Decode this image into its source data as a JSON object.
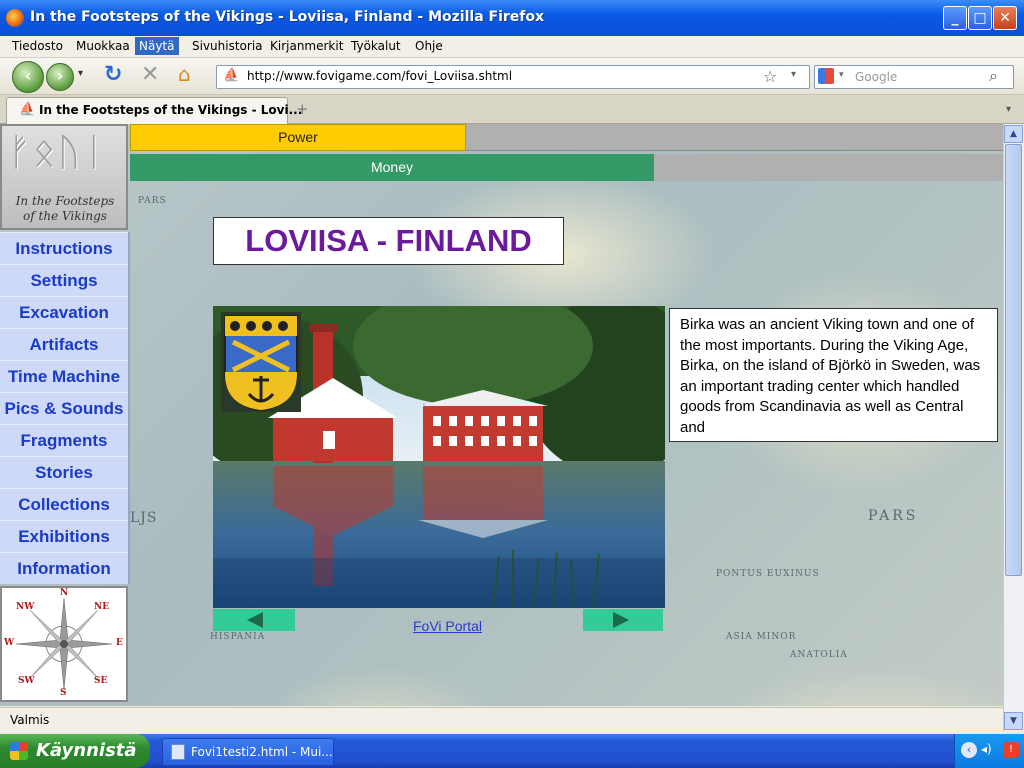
{
  "window": {
    "title": "In the Footsteps of the Vikings - Loviisa, Finland - Mozilla Firefox"
  },
  "menubar": {
    "items": [
      "Tiedosto",
      "Muokkaa",
      "Näytä",
      "Sivuhistoria",
      "Kirjanmerkit",
      "Työkalut",
      "Ohje"
    ],
    "selected": "Näytä"
  },
  "navbar": {
    "url": "http://www.fovigame.com/fovi_Loviisa.shtml",
    "search_placeholder": "Google"
  },
  "tabs": [
    {
      "label": "In the Footsteps of the Vikings - Lovi..."
    }
  ],
  "page": {
    "logo_text_1": "In the Footsteps",
    "logo_text_2": "of the Vikings",
    "power_label": "Power",
    "power_level": 0.35,
    "money_label": "Money",
    "money_level": 0.54,
    "sidebar": [
      "Instructions",
      "Settings",
      "Excavation",
      "Artifacts",
      "Time Machine",
      "Pics & Sounds",
      "Fragments",
      "Stories",
      "Collections",
      "Exhibitions",
      "Information"
    ],
    "compass": {
      "n": "N",
      "ne": "NE",
      "e": "E",
      "se": "SE",
      "s": "S",
      "sw": "SW",
      "w": "W",
      "nw": "NW"
    },
    "title": "LOVIISA - FINLAND",
    "description": "Birka was an ancient Viking town and one of the most importants. During the Viking Age, Birka, on the island of Björkö in Sweden, was an important trading center which handled goods from Scandinavia as well as Central and",
    "portal_link": "FoVi Portal",
    "map_labels": [
      "PARS",
      "LJS",
      "PARS",
      "PONTUS EUXINUS",
      "HISPANIA",
      "ASIA MINOR",
      "ANATOLIA"
    ]
  },
  "statusbar": {
    "text": "Valmis"
  },
  "taskbar": {
    "start_label": "Käynnistä",
    "task_item": "Fovi1testi2.html - Mui..."
  },
  "colors": {
    "power": "#ffcc00",
    "money": "#339966",
    "sidebar_bg": "#cdd9f6",
    "sidebar_text": "#1a3ac8",
    "title_text": "#6a1a9a",
    "arrow_button": "#33cc99"
  }
}
